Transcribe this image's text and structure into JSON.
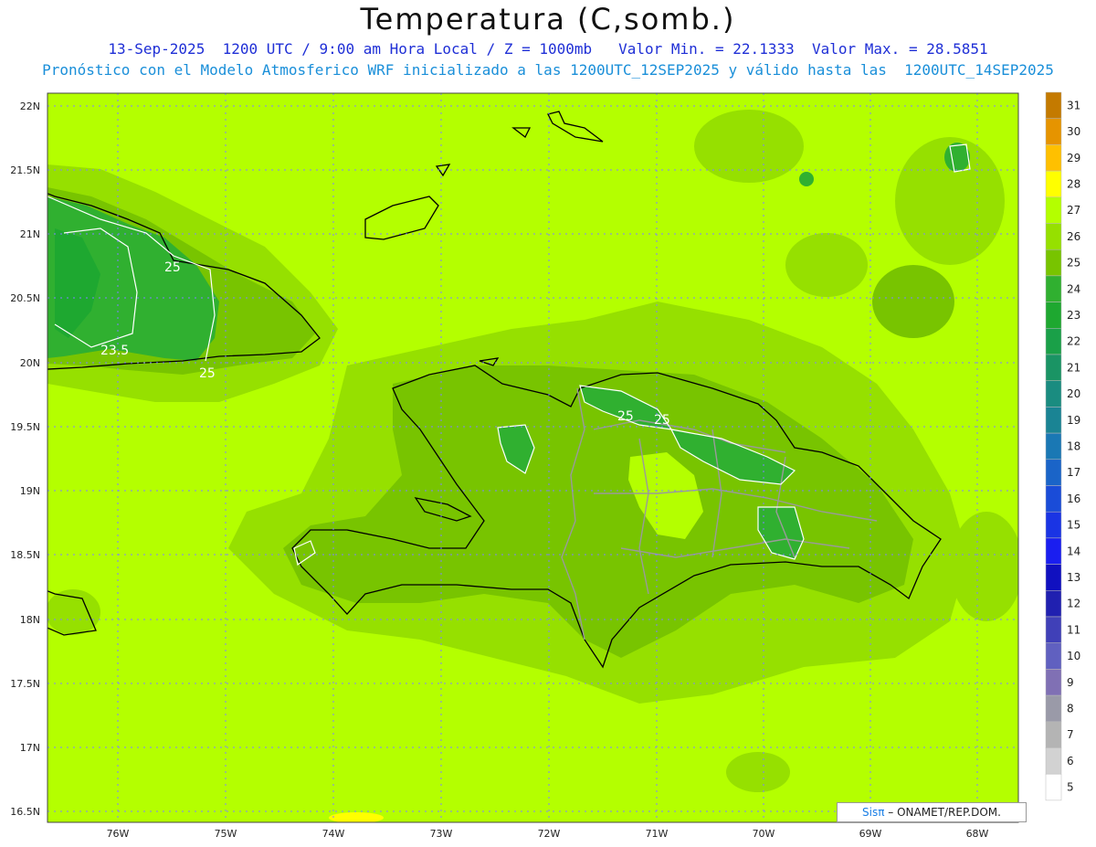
{
  "header": {
    "title": "Temperatura (C,somb.)",
    "line1": "13-Sep-2025  1200 UTC / 9:00 am Hora Local / Z = 1000mb   Valor Min. = 22.1333  Valor Max. = 28.5851",
    "line2": "Pronóstico con el Modelo Atmosferico WRF inicializado a las 1200UTC_12SEP2025 y válido hasta las  1200UTC_14SEP2025"
  },
  "axes": {
    "lat_labels": [
      "22N",
      "21.5N",
      "21N",
      "20.5N",
      "20N",
      "19.5N",
      "19N",
      "18.5N",
      "18N",
      "17.5N",
      "17N",
      "16.5N"
    ],
    "lon_labels": [
      "76W",
      "75W",
      "74W",
      "73W",
      "72W",
      "71W",
      "70W",
      "69W",
      "68W"
    ]
  },
  "contour_labels": [
    "25",
    "23.5",
    "25",
    "25",
    "25"
  ],
  "colorbar": {
    "labels": [
      "31",
      "30",
      "29",
      "28",
      "27",
      "26",
      "25",
      "24",
      "23",
      "22",
      "21",
      "20",
      "19",
      "18",
      "17",
      "16",
      "15",
      "14",
      "13",
      "12",
      "11",
      "10",
      "9",
      "8",
      "7",
      "6",
      "5"
    ],
    "colors": [
      "#c47a00",
      "#e69400",
      "#ffc000",
      "#ffff00",
      "#b4ff00",
      "#96e000",
      "#78c400",
      "#30b030",
      "#1ea830",
      "#1aa048",
      "#1a9464",
      "#1a8c80",
      "#1a8494",
      "#1a78b4",
      "#1a64c8",
      "#1a4cd8",
      "#1a34e4",
      "#1a1ef0",
      "#1010c0",
      "#2020b0",
      "#4040b8",
      "#6060c0",
      "#8070b4",
      "#9a9aa8",
      "#b4b4b4",
      "#d2d2d2",
      "#ffffff"
    ]
  },
  "map_colors": {
    "ocean": "#b4ff00",
    "land_26": "#96e000",
    "land_25": "#78c400",
    "land_24": "#30b030",
    "land_23": "#1ea830"
  },
  "credit": {
    "logo": "Sisπ",
    "text": " – ONAMET/REP.DOM."
  }
}
